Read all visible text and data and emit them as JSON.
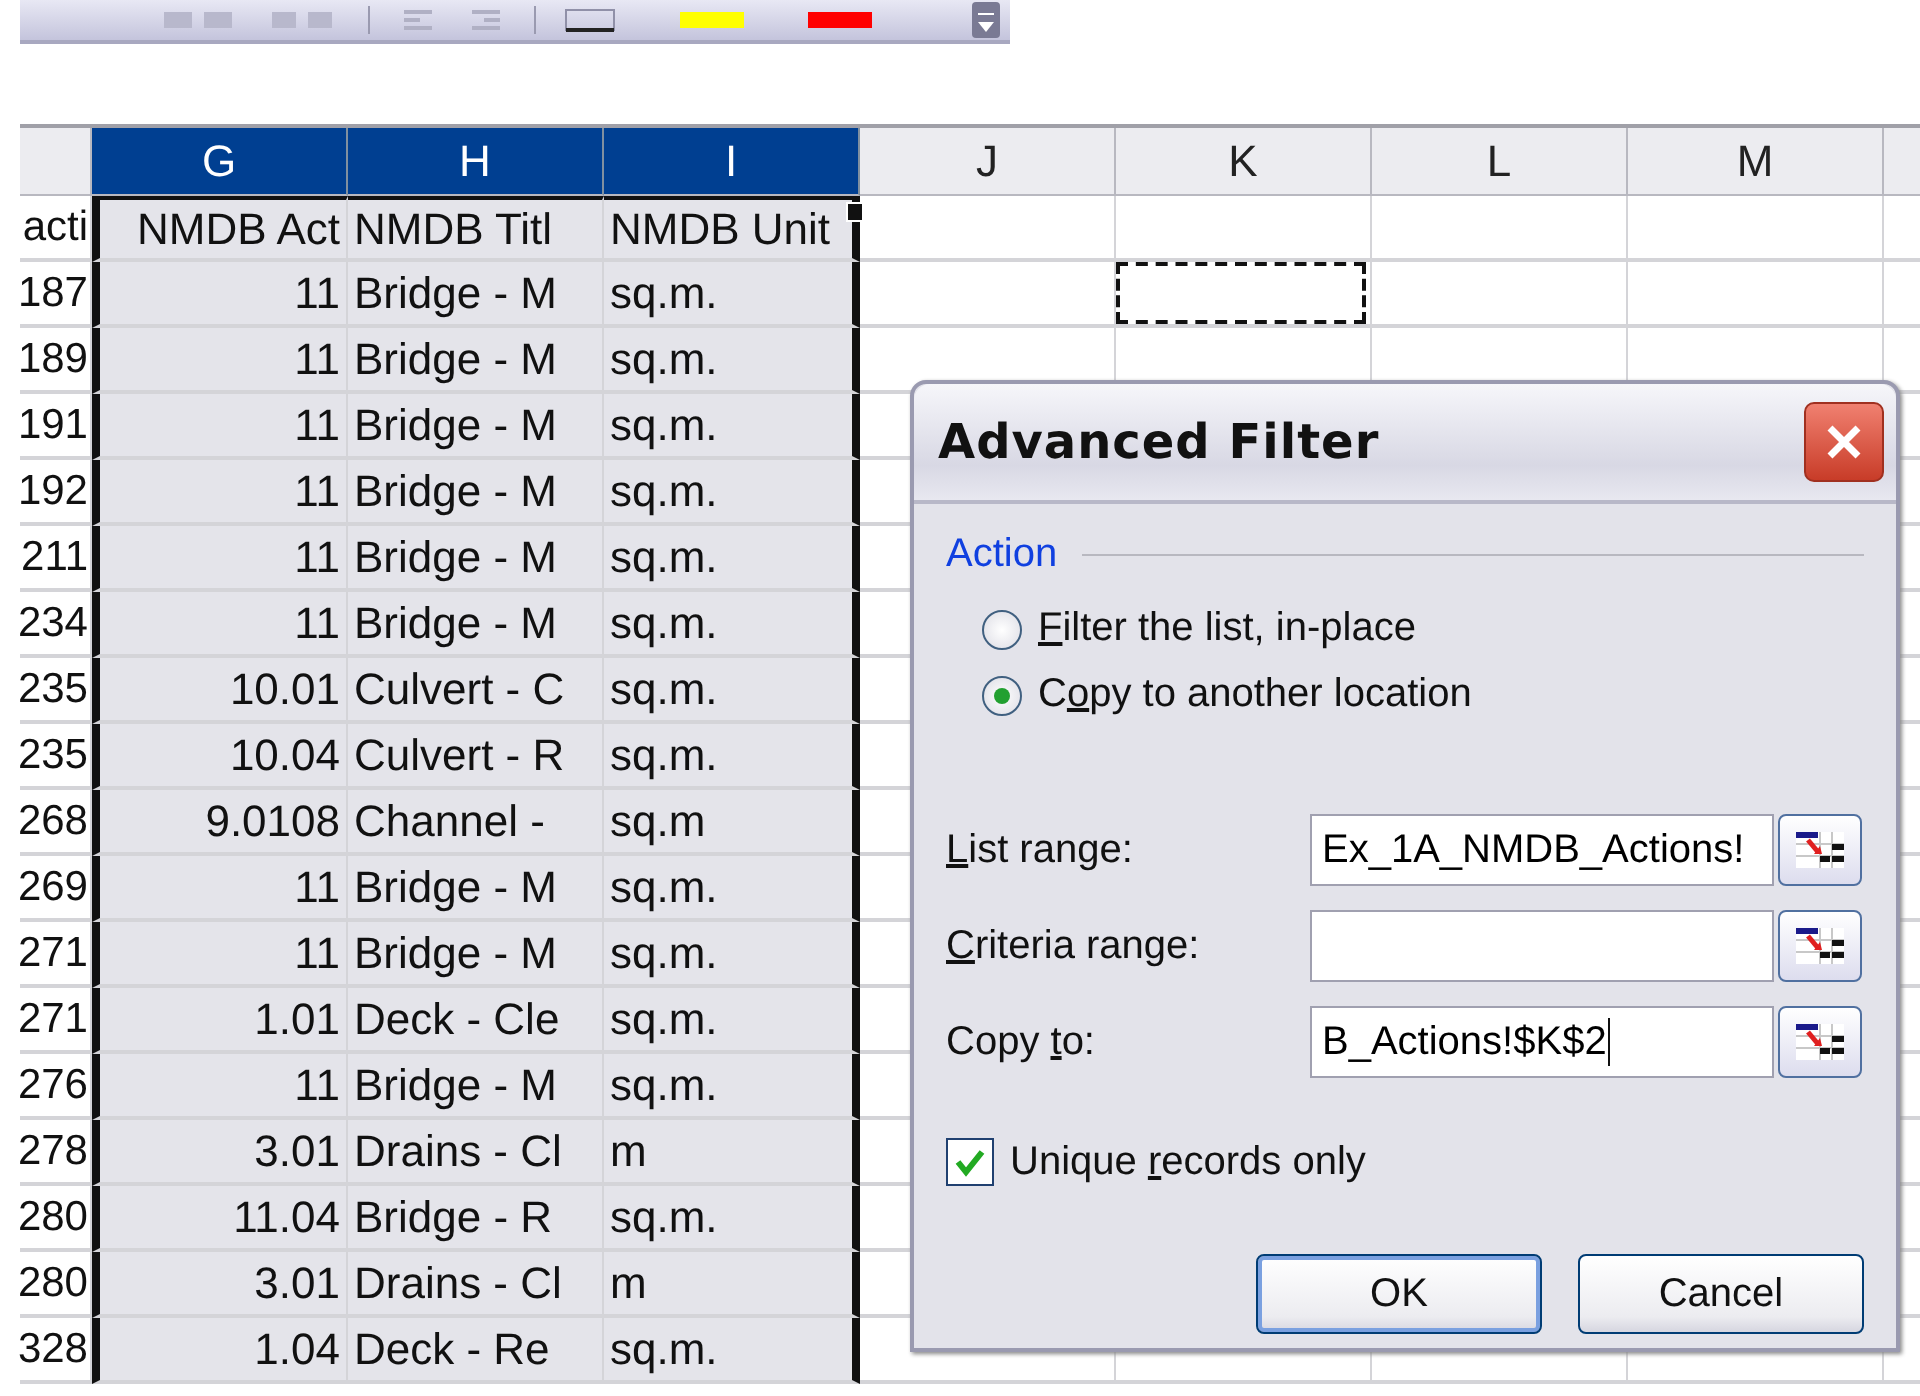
{
  "column_headers": [
    {
      "label": "G",
      "selected": true
    },
    {
      "label": "H",
      "selected": true
    },
    {
      "label": "I",
      "selected": true
    },
    {
      "label": "J",
      "selected": false
    },
    {
      "label": "K",
      "selected": false
    },
    {
      "label": "L",
      "selected": false
    },
    {
      "label": "M",
      "selected": false
    }
  ],
  "rows": [
    {
      "cells": [
        "acti",
        "NMDB Act",
        "NMDB Titl",
        "NMDB Unit"
      ]
    },
    {
      "cells": [
        "187",
        "11",
        "Bridge - M",
        "sq.m."
      ],
      "marquee": true
    },
    {
      "cells": [
        "189",
        "11",
        "Bridge - M",
        "sq.m."
      ]
    },
    {
      "cells": [
        "191",
        "11",
        "Bridge - M",
        "sq.m."
      ]
    },
    {
      "cells": [
        "192",
        "11",
        "Bridge - M",
        "sq.m."
      ]
    },
    {
      "cells": [
        "211",
        "11",
        "Bridge - M",
        "sq.m."
      ]
    },
    {
      "cells": [
        "234",
        "11",
        "Bridge - M",
        "sq.m."
      ]
    },
    {
      "cells": [
        "235",
        "10.01",
        "Culvert - C",
        "sq.m."
      ]
    },
    {
      "cells": [
        "235",
        "10.04",
        "Culvert - R",
        "sq.m."
      ]
    },
    {
      "cells": [
        "268",
        "9.0108",
        "Channel -",
        "sq.m"
      ]
    },
    {
      "cells": [
        "269",
        "11",
        "Bridge - M",
        "sq.m."
      ]
    },
    {
      "cells": [
        "271",
        "11",
        "Bridge - M",
        "sq.m."
      ]
    },
    {
      "cells": [
        "271",
        "1.01",
        "Deck - Cle",
        "sq.m."
      ]
    },
    {
      "cells": [
        "276",
        "11",
        "Bridge - M",
        "sq.m."
      ]
    },
    {
      "cells": [
        "278",
        "3.01",
        "Drains - Cl",
        "m"
      ]
    },
    {
      "cells": [
        "280",
        "11.04",
        "Bridge - R",
        "sq.m."
      ]
    },
    {
      "cells": [
        "280",
        "3.01",
        "Drains - Cl",
        "m"
      ]
    },
    {
      "cells": [
        "328",
        "1.04",
        "Deck - Re",
        "sq.m."
      ]
    }
  ],
  "dialog": {
    "title": "Advanced Filter",
    "group_label": "Action",
    "options": [
      {
        "mnemonic": "F",
        "after": "ilter the list, in-place",
        "selected": false
      },
      {
        "before": "C",
        "mnemonic": "o",
        "after": "py to another location",
        "selected": true
      }
    ],
    "fields": [
      {
        "mnemonic": "L",
        "after": "ist range:",
        "value": "Ex_1A_NMDB_Actions!"
      },
      {
        "mnemonic": "C",
        "after": "riteria range:"
      },
      {
        "before": "Copy ",
        "mnemonic": "t",
        "after": "o:",
        "value": "B_Actions!$K$2",
        "focused": true
      }
    ],
    "checkbox": {
      "before": "Unique ",
      "mnemonic": "r",
      "after": "ecords only",
      "checked": true
    },
    "buttons": [
      {
        "label": "OK",
        "default": true
      },
      {
        "label": "Cancel",
        "default": false
      }
    ]
  }
}
